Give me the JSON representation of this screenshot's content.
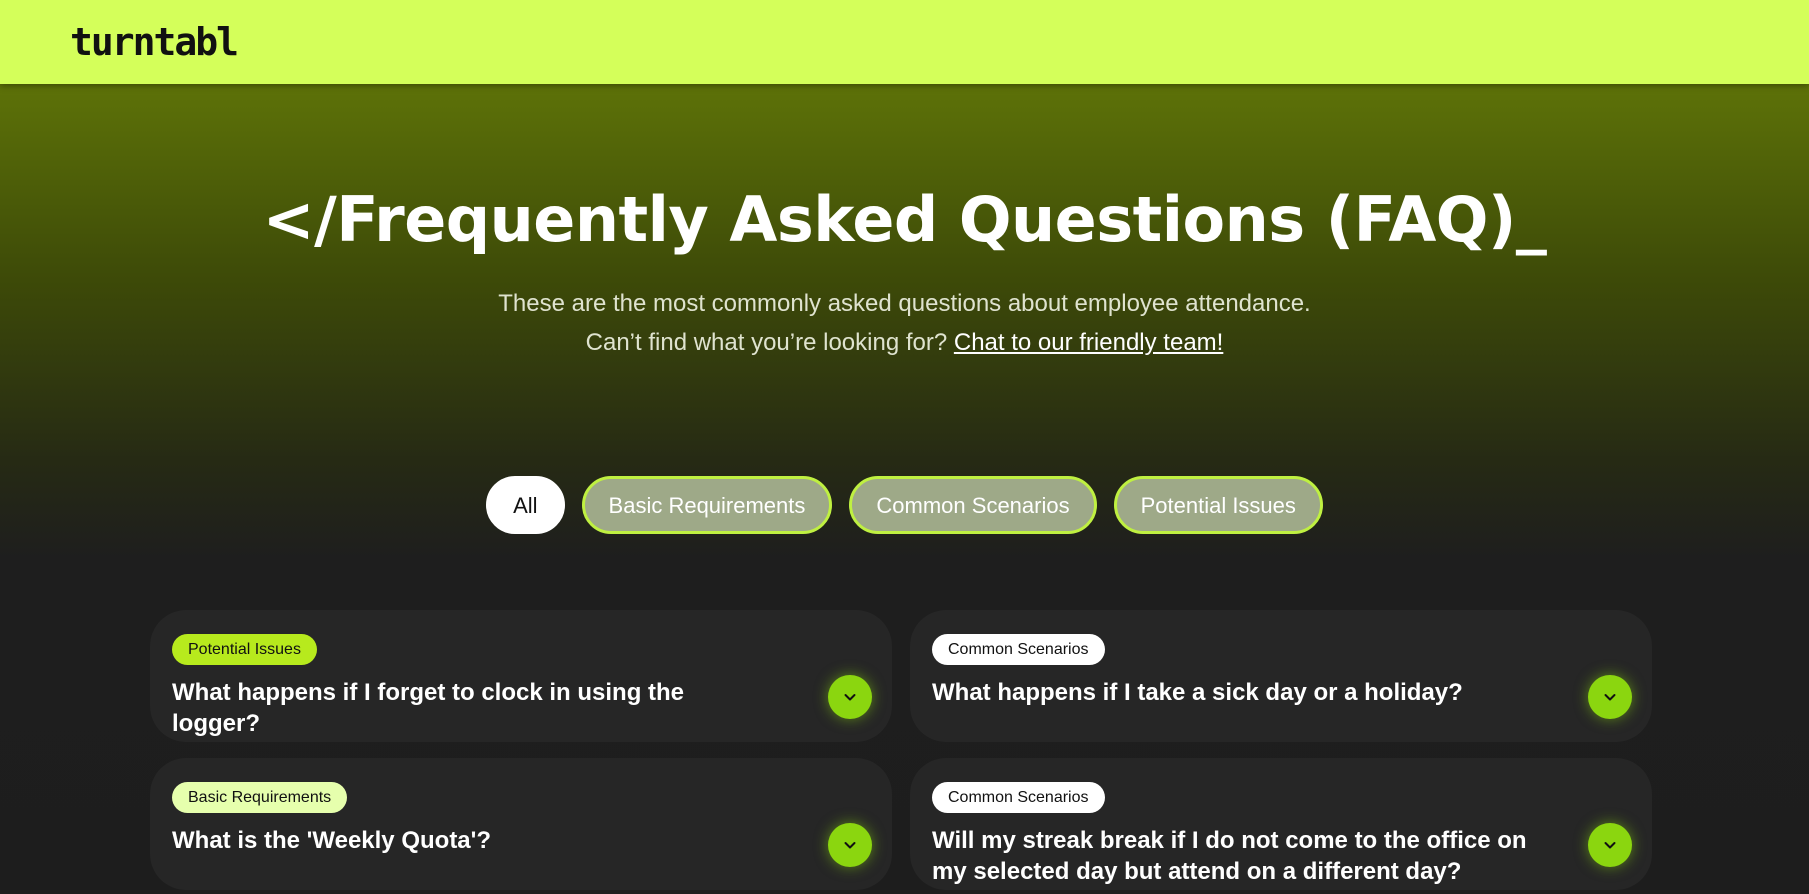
{
  "header": {
    "logo_text": "turntabl",
    "background": "#d4ff5a"
  },
  "hero": {
    "title": "</Frequently Asked Questions (FAQ)_",
    "subtitle_line1": "These are the most commonly asked questions about employee attendance.",
    "subtitle_line2_prefix": "Can’t find what you’re looking for? ",
    "subtitle_link": "Chat to our friendly team!"
  },
  "filters": [
    {
      "label": "All",
      "active": true
    },
    {
      "label": "Basic Requirements",
      "active": false
    },
    {
      "label": "Common Scenarios",
      "active": false
    },
    {
      "label": "Potential Issues",
      "active": false
    }
  ],
  "faqs": [
    {
      "tag": "Potential Issues",
      "tag_color": "#b7ea1d",
      "question": "What happens if I forget to clock in using the logger?",
      "icon": "chevron-down-icon"
    },
    {
      "tag": "Common Scenarios",
      "tag_color": "#ffffff",
      "question": "What happens if I take a sick day or a holiday?",
      "icon": "chevron-down-icon"
    },
    {
      "tag": "Basic Requirements",
      "tag_color": "#e6ffad",
      "question": "What is the 'Weekly Quota'?",
      "icon": "chevron-down-icon"
    },
    {
      "tag": "Common Scenarios",
      "tag_color": "#ffffff",
      "question": "Will my streak break if I do not come to the office on my selected day but attend on a different day?",
      "icon": "chevron-down-icon"
    }
  ],
  "colors": {
    "accent": "#8bd60f",
    "card_background": "#262626"
  }
}
